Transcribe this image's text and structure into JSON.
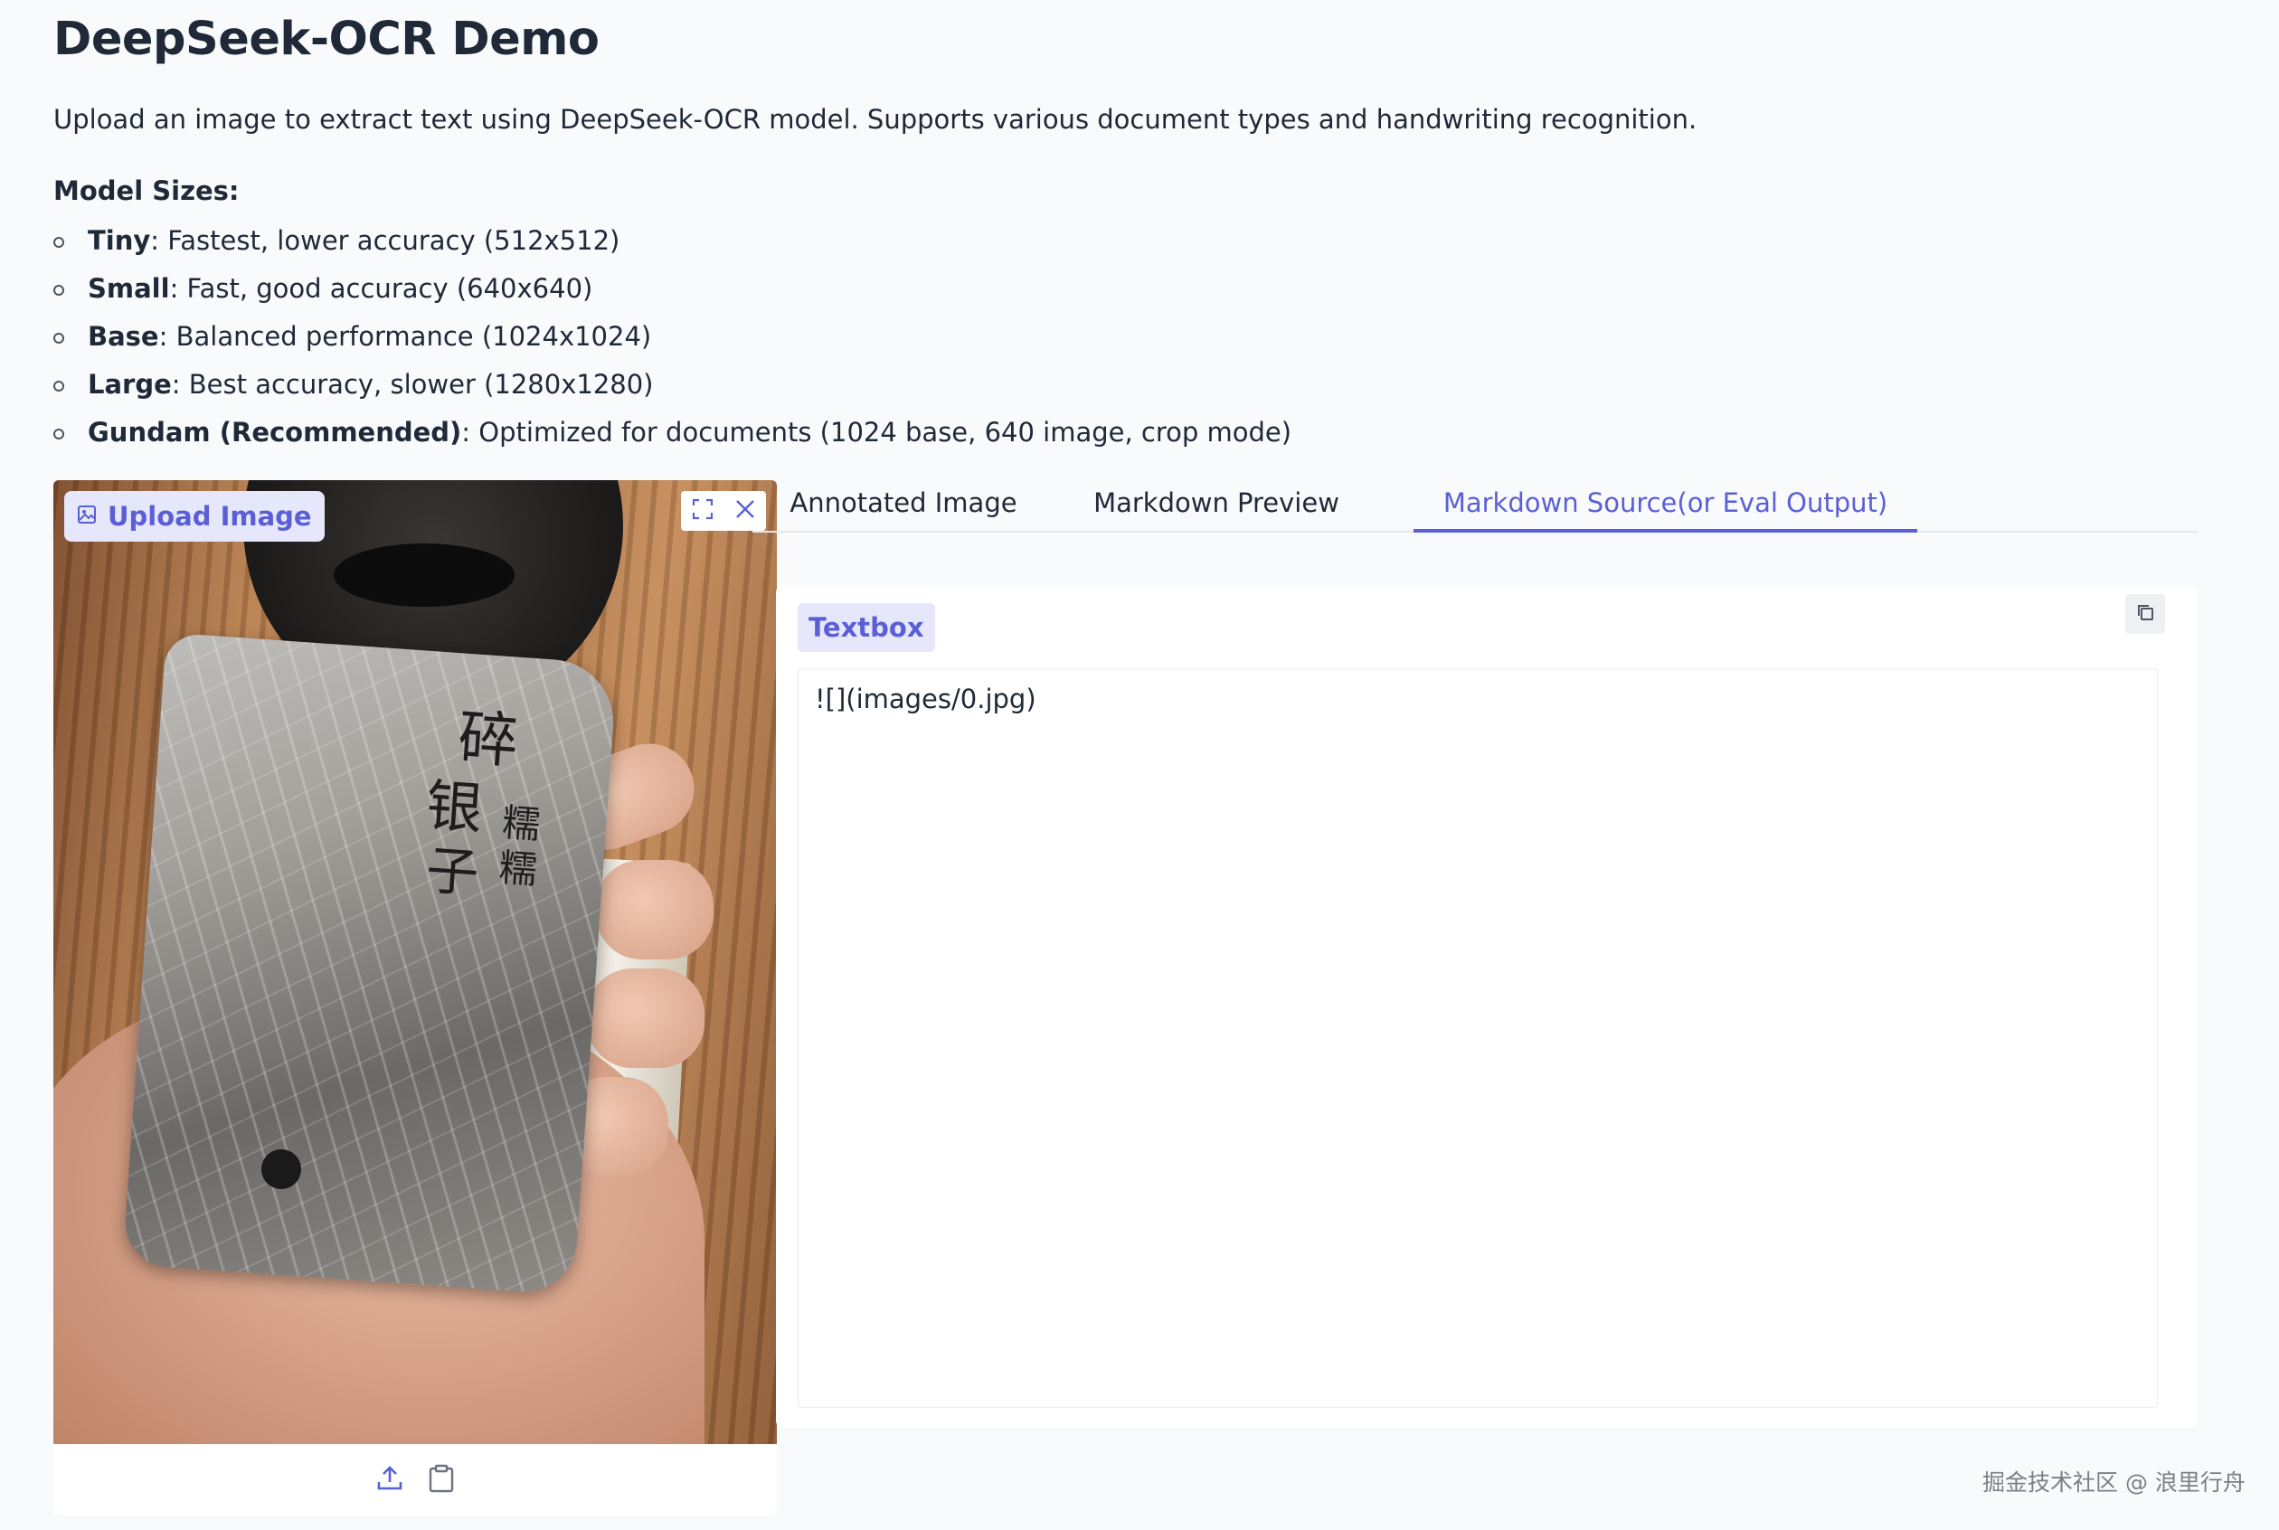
{
  "page": {
    "title": "DeepSeek-OCR Demo",
    "description": "Upload an image to extract text using DeepSeek-OCR model. Supports various document types and handwriting recognition.",
    "model_sizes_heading": "Model Sizes:",
    "model_sizes": [
      {
        "name": "Tiny",
        "detail": ": Fastest, lower accuracy (512x512)"
      },
      {
        "name": "Small",
        "detail": ": Fast, good accuracy (640x640)"
      },
      {
        "name": "Base",
        "detail": ": Balanced performance (1024x1024)"
      },
      {
        "name": "Large",
        "detail": ": Best accuracy, slower (1280x1280)"
      },
      {
        "name": "Gundam (Recommended)",
        "detail": ": Optimized for documents (1024 base, 640 image, crop mode)"
      }
    ]
  },
  "upload": {
    "label": "Upload Image",
    "photo_text": {
      "line1": "碎",
      "line2": "银",
      "line3": "子",
      "right1": "糯",
      "right2": "糯"
    }
  },
  "tabs": [
    {
      "label": "Annotated Image",
      "active": false
    },
    {
      "label": "Markdown Preview",
      "active": false
    },
    {
      "label": "Markdown Source(or Eval Output)",
      "active": true
    }
  ],
  "output": {
    "label": "Textbox",
    "value": "![](images/0.jpg)"
  },
  "watermark": "掘金技术社区 @ 浪里行舟",
  "colors": {
    "accent": "#5b5fd6",
    "accent_bg": "#e6e7fb",
    "background": "#f9fafc"
  }
}
